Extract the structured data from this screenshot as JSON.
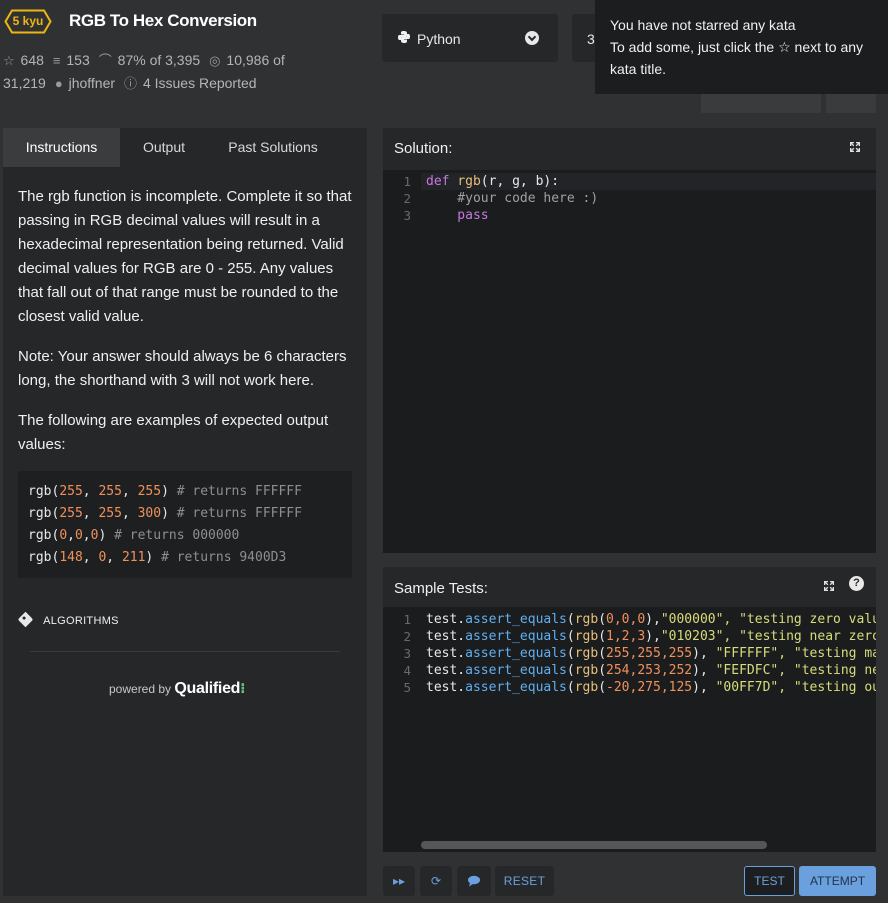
{
  "kata": {
    "rank": "5 kyu",
    "title": "RGB To Hex Conversion",
    "stats": {
      "stars": "648",
      "collections": "153",
      "satisfaction": "87% of 3,395",
      "completions": "10,986 of 31,219",
      "author": "jhoffner",
      "issues": "4 Issues Reported"
    }
  },
  "language_select": {
    "selected": "Python"
  },
  "version_select": {
    "selected": "3"
  },
  "tooltip": {
    "line1": "You have not starred any kata",
    "line2_before": "To add some, just click the",
    "line2_after": "next to any",
    "line3": "kata title."
  },
  "tabs": {
    "instructions": "Instructions",
    "output": "Output",
    "past_solutions": "Past Solutions"
  },
  "instructions": {
    "para1": "The rgb function is incomplete. Complete it so that passing in RGB decimal values will result in a hexadecimal representation being returned. Valid decimal values for RGB are 0 - 255. Any values that fall out of that range must be rounded to the closest valid value.",
    "para2": "Note: Your answer should always be 6 characters long, the shorthand with 3 will not work here.",
    "para3": "The following are examples of expected output values:",
    "examples": [
      {
        "fn": "rgb(",
        "args": [
          "255",
          "255",
          "255"
        ],
        "sep": [
          ", ",
          ", "
        ],
        "close": ")",
        "comment": " # returns FFFFFF"
      },
      {
        "fn": "rgb(",
        "args": [
          "255",
          "255",
          "300"
        ],
        "sep": [
          ", ",
          ", "
        ],
        "close": ")",
        "comment": " # returns FFFFFF"
      },
      {
        "fn": "rgb(",
        "args": [
          "0",
          "0",
          "0"
        ],
        "sep": [
          ",",
          ","
        ],
        "close": ")",
        "comment": " # returns 000000"
      },
      {
        "fn": "rgb(",
        "args": [
          "148",
          "0",
          "211"
        ],
        "sep": [
          ", ",
          ", "
        ],
        "close": ")",
        "comment": " # returns 9400D3"
      }
    ],
    "tag": "ALGORITHMS",
    "powered_by": "powered by",
    "brand": "Qualified"
  },
  "solution": {
    "title": "Solution:",
    "line_numbers": [
      "1",
      "2",
      "3"
    ],
    "line1": {
      "kw": "def",
      "name": "rgb",
      "rest": "(r, g, b):"
    },
    "line2": "    #your code here :)",
    "line3": "    pass"
  },
  "sample_tests": {
    "title": "Sample Tests:",
    "line_numbers": [
      "1",
      "2",
      "3",
      "4",
      "5"
    ],
    "lines": [
      {
        "args": "0,0,0",
        "sep": ",",
        "expected": "\"000000\"",
        "rest": ", \"testing zero value"
      },
      {
        "args": "1,2,3",
        "sep": ",",
        "expected": "\"010203\"",
        "rest": ", \"testing near zero"
      },
      {
        "args": "255,255,255",
        "sep": ", ",
        "expected": "\"FFFFFF\"",
        "rest": ", \"testing max"
      },
      {
        "args": "254,253,252",
        "sep": ", ",
        "expected": "\"FEFDFC\"",
        "rest": ", \"testing nea"
      },
      {
        "args": "-20,275,125",
        "sep": ", ",
        "expected": "\"00FF7D\"",
        "rest": ", \"testing out"
      }
    ]
  },
  "actions": {
    "reset": "RESET",
    "test": "TEST",
    "attempt": "ATTEMPT"
  },
  "icons": {
    "stars": "star-icon",
    "collections": "layers-icon",
    "satisfaction": "gauge-icon",
    "completions": "target-icon",
    "author": "user-icon",
    "issues": "info-icon",
    "language": "python-icon",
    "tag": "tag-icon",
    "expand": "expand-icon",
    "help": "help-icon",
    "skip": "fast-forward-icon",
    "refresh": "refresh-icon",
    "discuss": "chat-icon"
  },
  "colors": {
    "background": "#303133",
    "panel": "#262729",
    "editor": "#1b1c1e",
    "accent_blue": "#6aa0de",
    "rank_yellow": "#ecb613",
    "number_orange": "#f0915b",
    "keyword_purple": "#c678dd",
    "method_blue": "#61afef",
    "string_yellow": "#d8dc7a"
  }
}
